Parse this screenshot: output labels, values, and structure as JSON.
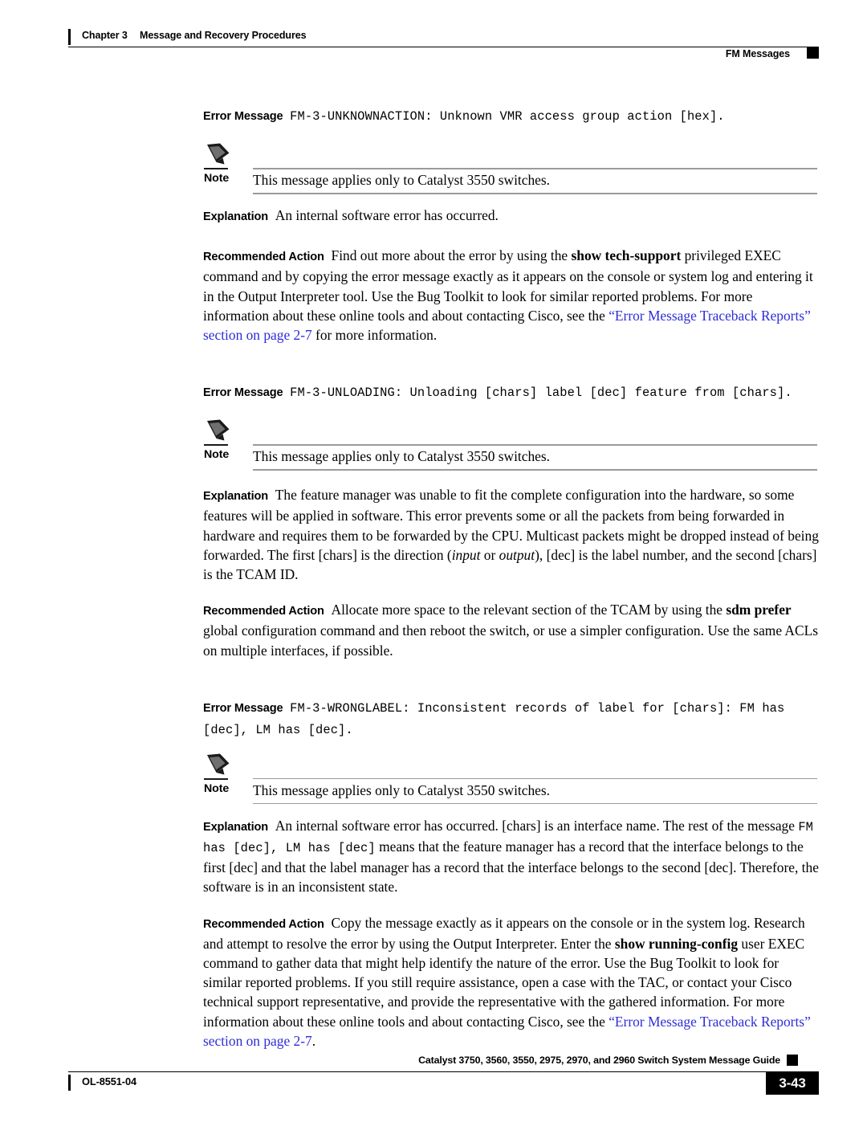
{
  "header": {
    "chapter": "Chapter 3",
    "chapter_title": "Message and Recovery Procedures",
    "section": "FM Messages"
  },
  "footer": {
    "guide_title": "Catalyst 3750, 3560, 3550, 2975, 2970, and 2960 Switch System Message Guide",
    "doc_id": "OL-8551-04",
    "page_number": "3-43"
  },
  "labels": {
    "error_message": "Error Message",
    "explanation": "Explanation",
    "recommended_action": "Recommended Action",
    "note": "Note"
  },
  "colors": {
    "link": "#2D2DD8",
    "rule": "#9a9a9a",
    "text": "#000000"
  },
  "messages": [
    {
      "id": "FM-3-UNKNOWNACTION",
      "error_message_code": "FM-3-UNKNOWNACTION: Unknown VMR access group action [hex].",
      "note": "This message applies only to Catalyst 3550 switches.",
      "explanation": "An internal software error has occurred.",
      "recommended_action": {
        "p1": "Find out more about the error by using the ",
        "cmd1": "show tech-support",
        "p2": " privileged EXEC command and by copying the error message exactly as it appears on the console or system log and entering it in the Output Interpreter tool. Use the Bug Toolkit to look for similar reported problems. For more information about these online tools and about contacting Cisco, see the ",
        "link": "“Error Message Traceback Reports” section on page 2-7",
        "p3": " for more information."
      }
    },
    {
      "id": "FM-3-UNLOADING",
      "error_message_code": "FM-3-UNLOADING: Unloading [chars] label [dec] feature from [chars].",
      "note": "This message applies only to Catalyst 3550 switches.",
      "explanation": {
        "p1": "The feature manager was unable to fit the complete configuration into the hardware, so some features will be applied in software. This error prevents some or all the packets from being forwarded in hardware and requires them to be forwarded by the CPU. Multicast packets might be dropped instead of being forwarded. The first [chars] is the direction (",
        "em1": "input",
        "p2": " or ",
        "em2": "output",
        "p3": "), [dec] is the label number, and the second [chars] is the TCAM ID."
      },
      "recommended_action": {
        "p1": "Allocate more space to the relevant section of the TCAM by using the ",
        "cmd1": "sdm prefer",
        "p2": " global configuration command and then reboot the switch, or use a simpler configuration. Use the same ACLs on multiple interfaces, if possible."
      }
    },
    {
      "id": "FM-3-WRONGLABEL",
      "error_message_code": "FM-3-WRONGLABEL: Inconsistent records of label for [chars]: FM has [dec], LM has [dec].",
      "note": "This message applies only to Catalyst 3550 switches.",
      "explanation": {
        "p1": "An internal software error has occurred. [chars] is an interface name. The rest of the message ",
        "mono1": "FM has [dec], LM has [dec]",
        "p2": " means that the feature manager has a record that the interface belongs to the first [dec] and that the label manager has a record that the interface belongs to the second [dec]. Therefore, the software is in an inconsistent state."
      },
      "recommended_action": {
        "p1": "Copy the message exactly as it appears on the console or in the system log. Research and attempt to resolve the error by using the Output Interpreter. Enter the ",
        "cmd1": "show running-config",
        "p2": " user EXEC command to gather data that might help identify the nature of the error. Use the Bug Toolkit to look for similar reported problems. If you still require assistance, open a case with the TAC, or contact your Cisco technical support representative, and provide the representative with the gathered information. For more information about these online tools and about contacting Cisco, see the ",
        "link": "“Error Message Traceback Reports” section on page 2-7",
        "p3": "."
      }
    }
  ]
}
